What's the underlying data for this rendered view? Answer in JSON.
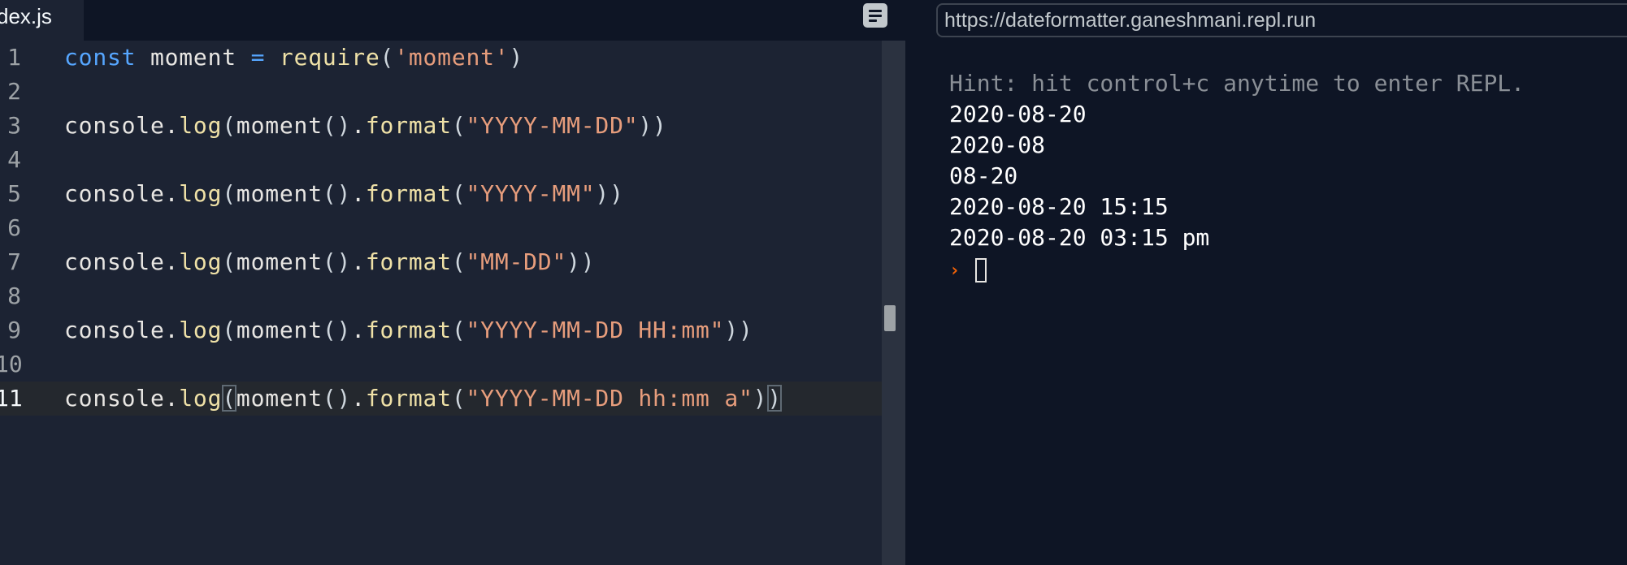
{
  "editor": {
    "tab_label": "dex.js",
    "format_button_icon": "format-align-icon",
    "lines": [
      {
        "number": "1",
        "text": "const moment = require('moment')"
      },
      {
        "number": "2",
        "text": ""
      },
      {
        "number": "3",
        "text": "console.log(moment().format(\"YYYY-MM-DD\"))"
      },
      {
        "number": "4",
        "text": ""
      },
      {
        "number": "5",
        "text": "console.log(moment().format(\"YYYY-MM\"))"
      },
      {
        "number": "6",
        "text": ""
      },
      {
        "number": "7",
        "text": "console.log(moment().format(\"MM-DD\"))"
      },
      {
        "number": "8",
        "text": ""
      },
      {
        "number": "9",
        "text": "console.log(moment().format(\"YYYY-MM-DD HH:mm\"))"
      },
      {
        "number": "10",
        "text": ""
      },
      {
        "number": "11",
        "text": "console.log(moment().format(\"YYYY-MM-DD hh:mm a\"))"
      }
    ],
    "active_line": "11"
  },
  "console": {
    "url": "https://dateformatter.ganeshmani.repl.run",
    "hint": "Hint: hit control+c anytime to enter REPL.",
    "output": [
      "2020-08-20",
      "2020-08",
      "08-20",
      "2020-08-20 15:15",
      "2020-08-20 03:15 pm"
    ],
    "prompt_glyph": "›"
  },
  "colors": {
    "editor_bg": "#1c2333",
    "console_bg": "#0e1525",
    "keyword": "#56a6ff",
    "function": "#efe1a7",
    "string": "#e79d7c",
    "prompt": "#f26207"
  }
}
